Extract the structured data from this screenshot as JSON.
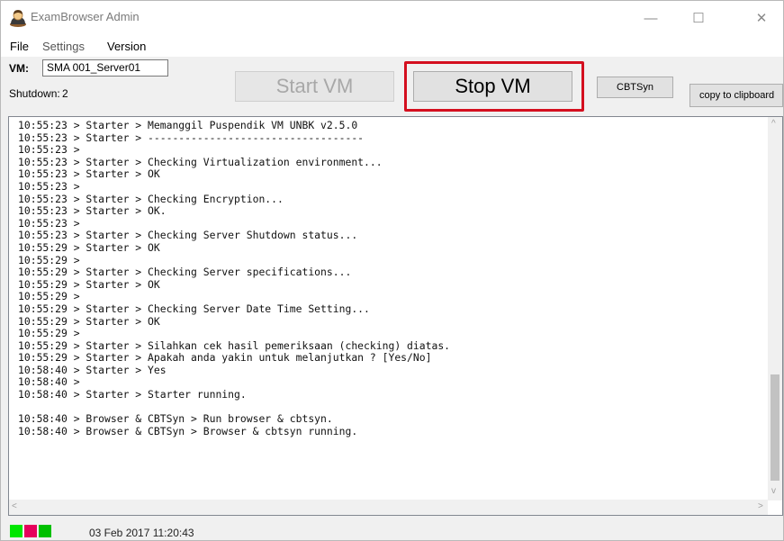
{
  "window": {
    "title": "ExamBrowser Admin",
    "controls": {
      "minimize": "—",
      "maximize": "☐",
      "close": "✕"
    }
  },
  "menu": {
    "items": [
      "File",
      "Settings",
      "Version"
    ]
  },
  "toolbar": {
    "vm_label": "VM:",
    "vm_value": "SMA 001_Server01",
    "shutdown_label": "Shutdown:",
    "shutdown_value": "2",
    "start_vm": "Start VM",
    "stop_vm": "Stop VM",
    "cbtsyn": "CBTSyn",
    "copy_clipboard": "copy to clipboard"
  },
  "console": {
    "lines": [
      "10:55:23 > Starter > Memanggil Puspendik VM UNBK v2.5.0",
      "10:55:23 > Starter > -----------------------------------",
      "10:55:23 >",
      "10:55:23 > Starter > Checking Virtualization environment...",
      "10:55:23 > Starter > OK",
      "10:55:23 >",
      "10:55:23 > Starter > Checking Encryption...",
      "10:55:23 > Starter > OK.",
      "10:55:23 >",
      "10:55:23 > Starter > Checking Server Shutdown status...",
      "10:55:29 > Starter > OK",
      "10:55:29 >",
      "10:55:29 > Starter > Checking Server specifications...",
      "10:55:29 > Starter > OK",
      "10:55:29 >",
      "10:55:29 > Starter > Checking Server Date Time Setting...",
      "10:55:29 > Starter > OK",
      "10:55:29 >",
      "10:55:29 > Starter > Silahkan cek hasil pemeriksaan (checking) diatas.",
      "10:55:29 > Starter > Apakah anda yakin untuk melanjutkan ? [Yes/No]",
      "10:58:40 > Starter > Yes",
      "10:58:40 >",
      "10:58:40 > Starter > Starter running.",
      "",
      "10:58:40 > Browser & CBTSyn > Run browser & cbtsyn.",
      "10:58:40 > Browser & CBTSyn > Browser & cbtsyn running."
    ]
  },
  "status": {
    "datetime": "03 Feb 2017 11:20:43",
    "indicator_colors": [
      "#00e600",
      "#e6005c",
      "#00c000"
    ]
  },
  "colors": {
    "highlight": "#d40f1f"
  }
}
